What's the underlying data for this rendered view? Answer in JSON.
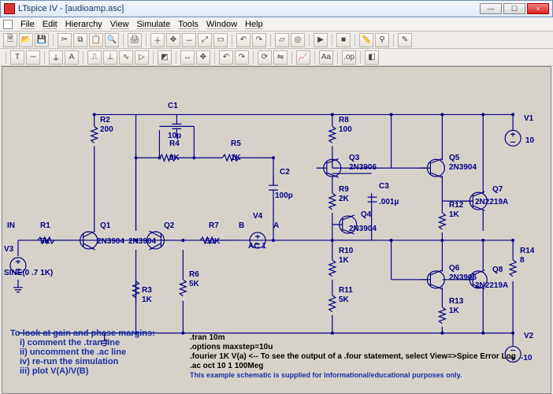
{
  "app": {
    "title": "LTspice IV - [audioamp.asc]",
    "menus": [
      "File",
      "Edit",
      "Hierarchy",
      "View",
      "Simulate",
      "Tools",
      "Window",
      "Help"
    ],
    "window_buttons": {
      "min": "—",
      "max": "☐",
      "close": "×"
    }
  },
  "toolbar1": [
    "new",
    "open",
    "save",
    "|",
    "cut",
    "copy",
    "paste",
    "find",
    "|",
    "print",
    "|",
    "zoom-in",
    "pan",
    "zoom-out",
    "zoom-fit",
    "zoom-rect",
    "|",
    "undo",
    "redo",
    "|",
    "sel",
    "marker",
    "|",
    "run",
    "|",
    "stop",
    "|",
    "ruler",
    "probe",
    "|",
    "notes",
    "|",
    "text",
    "wire",
    "|",
    "gnd",
    "label",
    "|",
    "res",
    "cap",
    "ind",
    "diode",
    "|",
    "comp",
    "|",
    "move",
    "drag",
    "|",
    "undo",
    "redo",
    "|",
    "rot",
    "mir",
    "|",
    "plot",
    "|",
    "txt",
    "|",
    "op",
    "|",
    "hier"
  ],
  "designators": {
    "R1": {
      "value": "5K"
    },
    "R2": {
      "value": "200"
    },
    "R3": {
      "value": "1K"
    },
    "R4": {
      "value": "9K"
    },
    "R5": {
      "value": "1K"
    },
    "R6": {
      "value": "5K"
    },
    "R7": {
      "value": "50K"
    },
    "R8": {
      "value": "100"
    },
    "R9": {
      "value": "2K"
    },
    "R10": {
      "value": "1K"
    },
    "R11": {
      "value": "5K"
    },
    "R12": {
      "value": "1K"
    },
    "R13": {
      "value": "1K"
    },
    "R14": {
      "value": "8"
    },
    "C1": {
      "value": "10p"
    },
    "C2": {
      "value": "100p"
    },
    "C3": {
      "value": ".001µ"
    },
    "Q1": {
      "value": "2N3904"
    },
    "Q2": {
      "value": "2N3904"
    },
    "Q3": {
      "value": "2N3906"
    },
    "Q4": {
      "value": "2N3904"
    },
    "Q5": {
      "value": "2N3904"
    },
    "Q6": {
      "value": "2N3906"
    },
    "Q7": {
      "value": "2N2219A"
    },
    "Q8": {
      "value": "2N2219A"
    },
    "V1": {
      "value": "10"
    },
    "V2": {
      "value": "-10"
    },
    "V3": {
      "value": "SINE(0 .7 1K)"
    },
    "V4": {
      "value": "AC 1"
    }
  },
  "nets": {
    "IN": "IN",
    "A": "A",
    "B": "B"
  },
  "notes": {
    "heading": "To look at gain and phase margins:",
    "lines": [
      "i) comment the .tran line",
      "ii) uncomment the .ac line",
      "iv) re-run the simulation",
      "iii) plot V(A)/V(B)"
    ]
  },
  "directives": [
    ".tran 10m",
    ".options maxstep=10u",
    ".fourier 1K V(a)  <-- To see the output of a .four statement, select View=>Spice Error Log",
    ".ac oct 10 1 100Meg"
  ],
  "disclaimer": "This example schematic is supplied for informational/educational purposes only."
}
